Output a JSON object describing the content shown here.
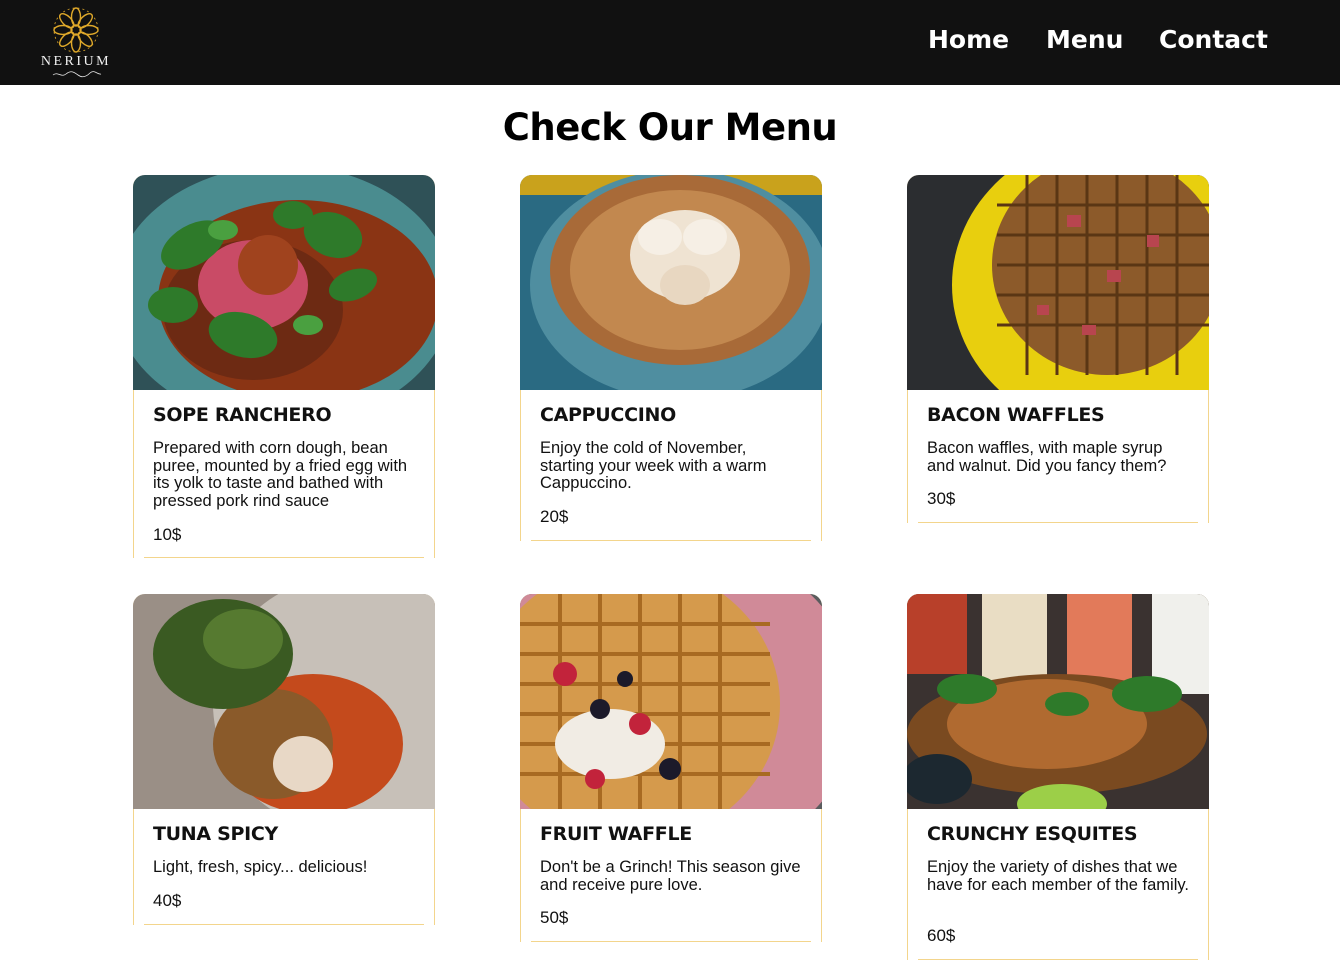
{
  "header": {
    "logo_text": "NERIUM",
    "nav": [
      {
        "label": "Home"
      },
      {
        "label": "Menu"
      },
      {
        "label": "Contact"
      }
    ]
  },
  "main": {
    "title": "Check Our Menu",
    "items": [
      {
        "name": "SOPE RANCHERO",
        "description": "Prepared with corn dough, bean puree, mounted by a fried egg with its yolk to taste and bathed with pressed pork rind sauce",
        "price": "10$"
      },
      {
        "name": "CAPPUCCINO",
        "description": "Enjoy the cold of November, starting your week with a warm Cappuccino.",
        "price": "20$"
      },
      {
        "name": "BACON WAFFLES",
        "description": "Bacon waffles, with maple syrup and walnut. Did you fancy them?",
        "price": "30$"
      },
      {
        "name": "TUNA SPICY",
        "description": "Light, fresh, spicy... delicious!",
        "price": "40$"
      },
      {
        "name": "FRUIT WAFFLE",
        "description": "Don't be a Grinch! This season give and receive pure love.",
        "price": "50$"
      },
      {
        "name": "CRUNCHY ESQUITES",
        "description": "Enjoy the variety of dishes that we have for each member of the family.",
        "price": "60$"
      }
    ]
  },
  "colors": {
    "navbar": "#111111",
    "logo_gold": "#e0a92a",
    "card_border": "#f3d58c"
  }
}
